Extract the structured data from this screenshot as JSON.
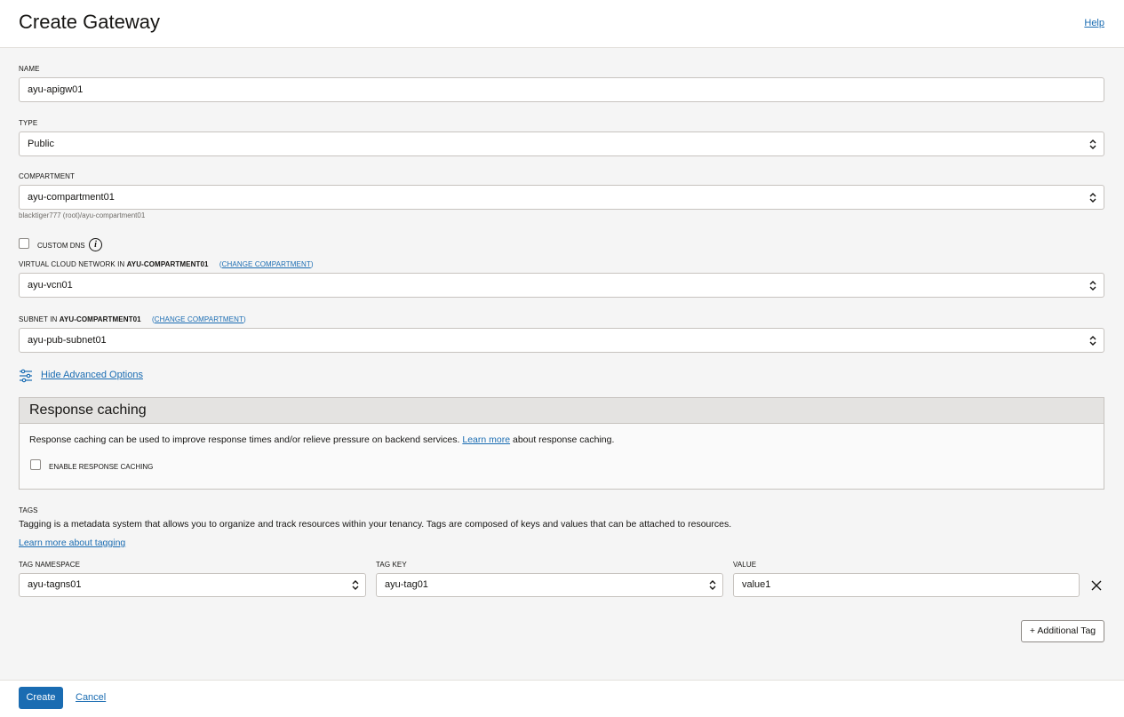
{
  "header": {
    "title": "Create Gateway",
    "help": "Help"
  },
  "form": {
    "name": {
      "label": "NAME",
      "value": "ayu-apigw01"
    },
    "type": {
      "label": "TYPE",
      "value": "Public"
    },
    "compartment": {
      "label": "COMPARTMENT",
      "value": "ayu-compartment01",
      "path": "blacktiger777 (root)/ayu-compartment01"
    },
    "custom_dns": {
      "label": "CUSTOM DNS"
    },
    "vcn": {
      "label_prefix": "VIRTUAL CLOUD NETWORK IN",
      "label_compartment": "AYU-COMPARTMENT01",
      "change_label": "CHANGE COMPARTMENT",
      "value": "ayu-vcn01"
    },
    "subnet": {
      "label_prefix": "SUBNET IN",
      "label_compartment": "AYU-COMPARTMENT01",
      "change_label": "CHANGE COMPARTMENT",
      "value": "ayu-pub-subnet01"
    },
    "advanced_toggle": "Hide Advanced Options"
  },
  "response_caching": {
    "title": "Response caching",
    "desc_before": "Response caching can be used to improve response times and/or relieve pressure on backend services.",
    "learn_more": "Learn more",
    "desc_after": "about response caching.",
    "enable_label": "ENABLE RESPONSE CACHING"
  },
  "tags": {
    "label": "TAGS",
    "description": "Tagging is a metadata system that allows you to organize and track resources within your tenancy. Tags are composed of keys and values that can be attached to resources.",
    "learn_more": "Learn more about tagging",
    "namespace_label": "TAG NAMESPACE",
    "namespace_value": "ayu-tagns01",
    "key_label": "TAG KEY",
    "key_value": "ayu-tag01",
    "value_label": "VALUE",
    "value_value": "value1",
    "add_button": "+ Additional Tag"
  },
  "footer": {
    "create": "Create",
    "cancel": "Cancel"
  },
  "colors": {
    "accent": "#1a6cb2",
    "background": "#f5f5f5",
    "panel_header": "#e4e3e1"
  }
}
